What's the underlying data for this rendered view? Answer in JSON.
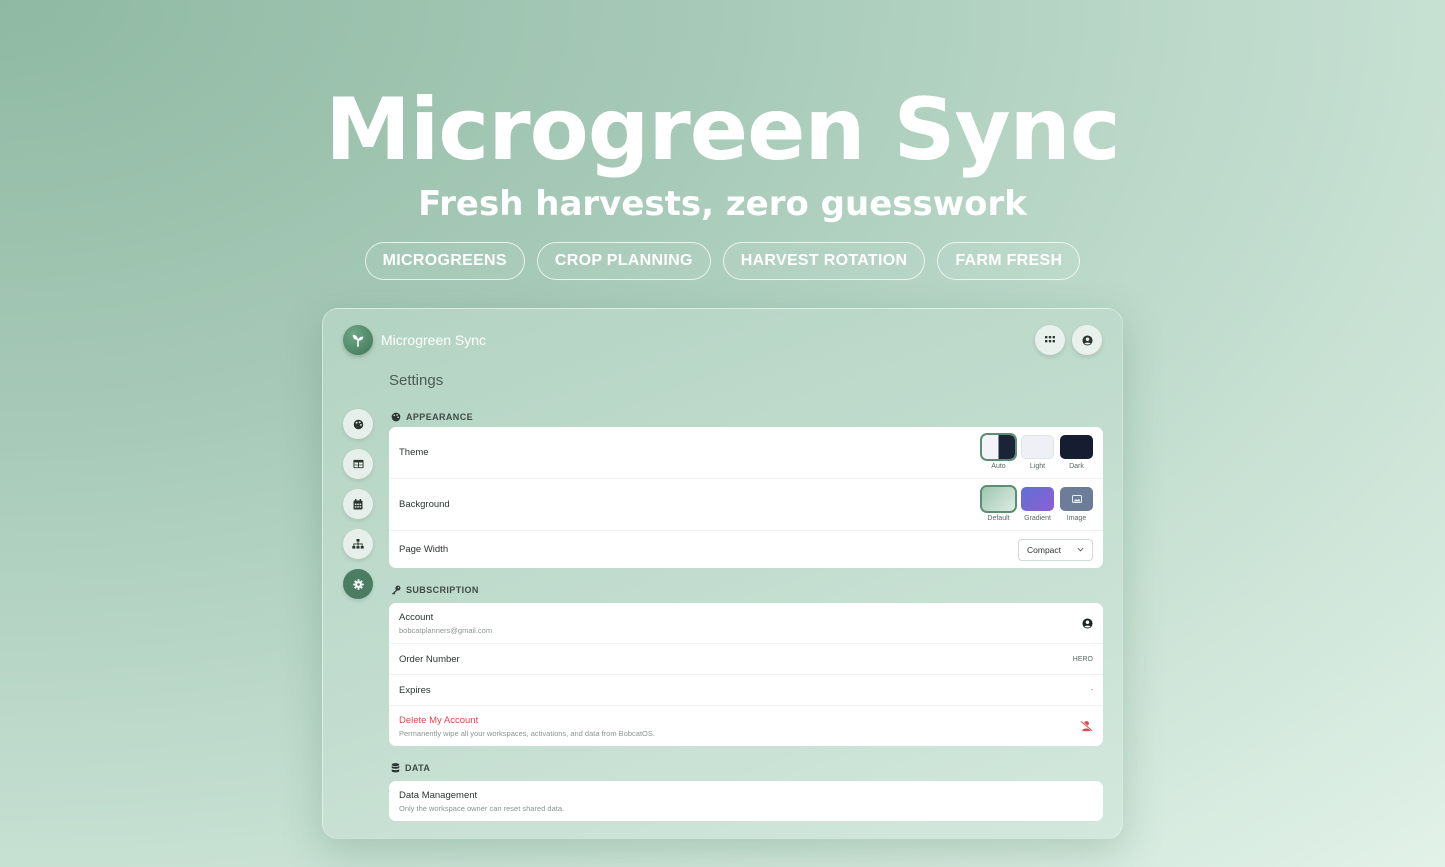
{
  "hero": {
    "title": "Microgreen Sync",
    "subtitle": "Fresh harvests, zero guesswork",
    "tags": [
      "MICROGREENS",
      "CROP PLANNING",
      "HARVEST ROTATION",
      "FARM FRESH"
    ]
  },
  "app": {
    "brand_name": "Microgreen Sync",
    "page_title": "Settings",
    "colors": {
      "accent": "#4a7d61",
      "danger": "#e0484f",
      "background": "#c2ddcf"
    },
    "top_buttons": [
      "apps-grid-icon",
      "user-circle-icon"
    ],
    "sidenav": [
      {
        "icon": "palette-icon",
        "active": false
      },
      {
        "icon": "table-icon",
        "active": false
      },
      {
        "icon": "calendar-icon",
        "active": false
      },
      {
        "icon": "sitemap-icon",
        "active": false
      },
      {
        "icon": "gear-icon",
        "active": true
      }
    ]
  },
  "appearance": {
    "label": "APPEARANCE",
    "theme": {
      "label": "Theme",
      "options": [
        "Auto",
        "Light",
        "Dark"
      ],
      "selected": "Auto"
    },
    "background": {
      "label": "Background",
      "options": [
        "Default",
        "Gradient",
        "Image"
      ],
      "selected": "Default"
    },
    "page_width": {
      "label": "Page Width",
      "value": "Compact"
    }
  },
  "subscription": {
    "label": "SUBSCRIPTION",
    "account": {
      "label": "Account",
      "email": "bobcatplanners@gmail.com"
    },
    "order_number": {
      "label": "Order Number",
      "value": "HERO"
    },
    "expires": {
      "label": "Expires",
      "value": "-"
    },
    "delete": {
      "label": "Delete My Account",
      "description": "Permanently wipe all your workspaces, activations, and data from BobcatOS."
    }
  },
  "data": {
    "label": "DATA",
    "management": {
      "label": "Data Management",
      "description": "Only the workspace owner can reset shared data."
    }
  }
}
